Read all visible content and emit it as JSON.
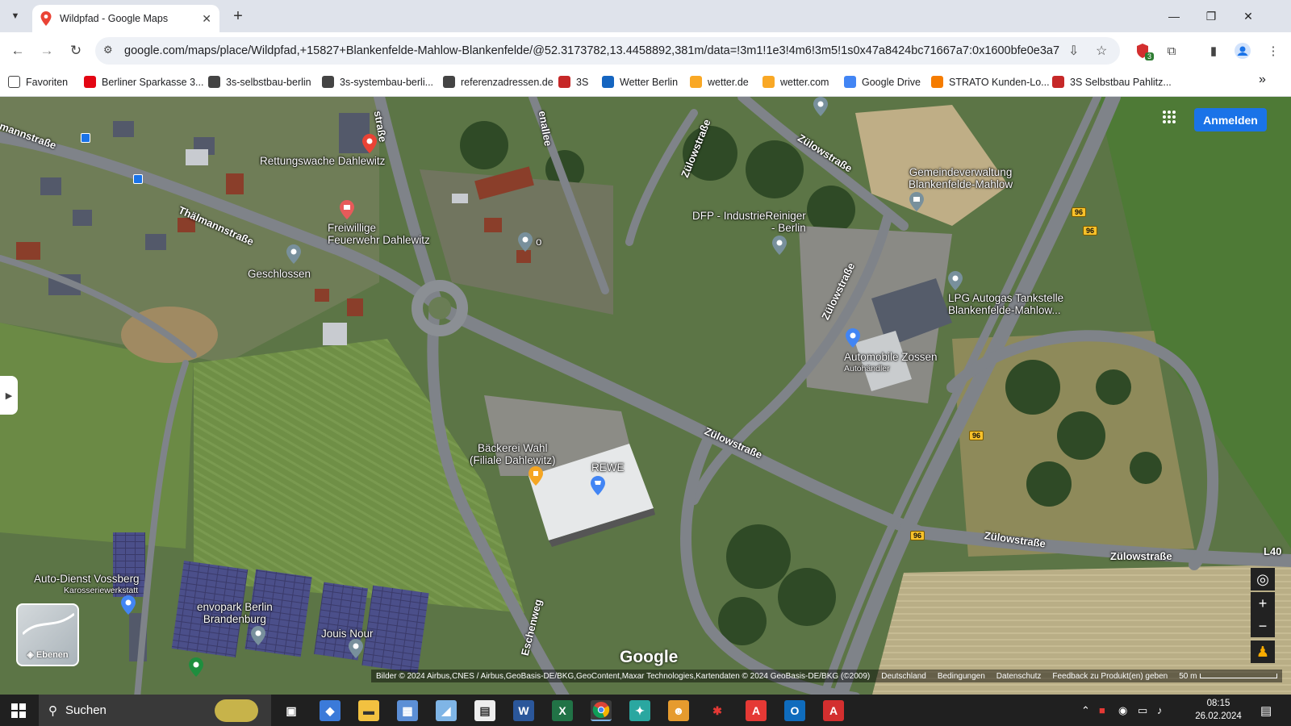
{
  "browser": {
    "tab_title": "Wildpfad - Google Maps",
    "url": "google.com/maps/place/Wildpfad,+15827+Blankenfelde-Mahlow-Blankenfelde/@52.3173782,13.4458892,381m/data=!3m1!1e3!4m6!3m5!1s0x47a8424bc71667a7:0x1600bfe0e3a7196!8...",
    "extension_badge": "3"
  },
  "bookmarks": [
    {
      "label": "Favoriten",
      "icon": "folder-icon",
      "color": "#444444"
    },
    {
      "label": "Berliner Sparkasse 3...",
      "icon": "sparkasse-icon",
      "color": "#e30613"
    },
    {
      "label": "3s-selbstbau-berlin",
      "icon": "globe-icon",
      "color": "#444444"
    },
    {
      "label": "3s-systembau-berli...",
      "icon": "globe-icon",
      "color": "#444444"
    },
    {
      "label": "referenzadressen.de",
      "icon": "globe-icon",
      "color": "#444444"
    },
    {
      "label": "3S",
      "icon": "3s-icon",
      "color": "#c62828"
    },
    {
      "label": "Wetter Berlin",
      "icon": "weather-icon",
      "color": "#1565c0"
    },
    {
      "label": "wetter.de",
      "icon": "sun-icon",
      "color": "#f9a825"
    },
    {
      "label": "wetter.com",
      "icon": "wetter-com-icon",
      "color": "#f9a825"
    },
    {
      "label": "Google Drive",
      "icon": "google-icon",
      "color": "#4285f4"
    },
    {
      "label": "STRATO Kunden-Lo...",
      "icon": "strato-icon",
      "color": "#f57c00"
    },
    {
      "label": "3S Selbstbau Pahlitz...",
      "icon": "3s-icon",
      "color": "#c62828"
    }
  ],
  "map": {
    "signin_label": "Anmelden",
    "layers_label": "Ebenen",
    "logo": "Google",
    "places": [
      {
        "name": "Rettungswache Dahlewitz",
        "sub": ""
      },
      {
        "name": "Freiwillige\nFeuerwehr Dahlewitz",
        "sub": ""
      },
      {
        "name": "Geschlossen",
        "sub": ""
      },
      {
        "name": "DFP - IndustrieReiniger\n- Berlin",
        "sub": ""
      },
      {
        "name": "Gemeindeverwaltung\nBlankenfelde-Mahlow",
        "sub": ""
      },
      {
        "name": "LPG Autogas Tankstelle\nBlankenfelde-Mahlow...",
        "sub": ""
      },
      {
        "name": "Automobile Zossen",
        "sub": "Autohändler"
      },
      {
        "name": "Bäckerei Wahl\n(Filiale Dahlewitz)",
        "sub": ""
      },
      {
        "name": "REWE",
        "sub": ""
      },
      {
        "name": "Auto-Dienst Vossberg",
        "sub": "Karosseriewerkstatt"
      },
      {
        "name": "envopark Berlin\nBrandenburg",
        "sub": ""
      },
      {
        "name": "Jouis Nour",
        "sub": ""
      },
      {
        "name": "o",
        "sub": ""
      }
    ],
    "roads": [
      "mannstraße",
      "Thälmannstraße",
      "straße",
      "enallee",
      "Zülowstraße",
      "Zülowstraße",
      "Zülowstraße",
      "Zülowstraße",
      "Zülowstraße",
      "Zülowstraße",
      "Eschenweg",
      "L40"
    ],
    "route_shields": [
      "96",
      "96",
      "96",
      "96"
    ],
    "attribution": [
      "Bilder © 2024 Airbus,CNES / Airbus,GeoBasis-DE/BKG,GeoContent,Maxar Technologies,Kartendaten © 2024 GeoBasis-DE/BKG (©2009)",
      "Deutschland",
      "Bedingungen",
      "Datenschutz",
      "Feedback zu Produkt(en) geben"
    ],
    "scale_label": "50 m"
  },
  "taskbar": {
    "search_placeholder": "Suchen",
    "time": "08:15",
    "date": "26.02.2024"
  }
}
